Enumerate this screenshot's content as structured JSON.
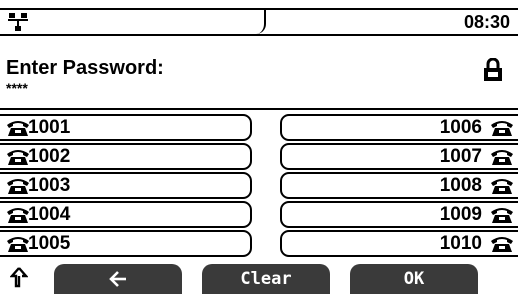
{
  "status": {
    "network_icon": "network-icon",
    "time": "08:30"
  },
  "password": {
    "title": "Enter Password:",
    "value": "****",
    "lock_icon": "lock-icon"
  },
  "speed_dial": {
    "left": [
      "1001",
      "1002",
      "1003",
      "1004",
      "1005"
    ],
    "right": [
      "1006",
      "1007",
      "1008",
      "1009",
      "1010"
    ],
    "icon": "phone-icon"
  },
  "softkeys": {
    "shift_icon": "shift-up-icon",
    "back_icon": "arrow-left-icon",
    "clear": "Clear",
    "ok": "OK"
  }
}
